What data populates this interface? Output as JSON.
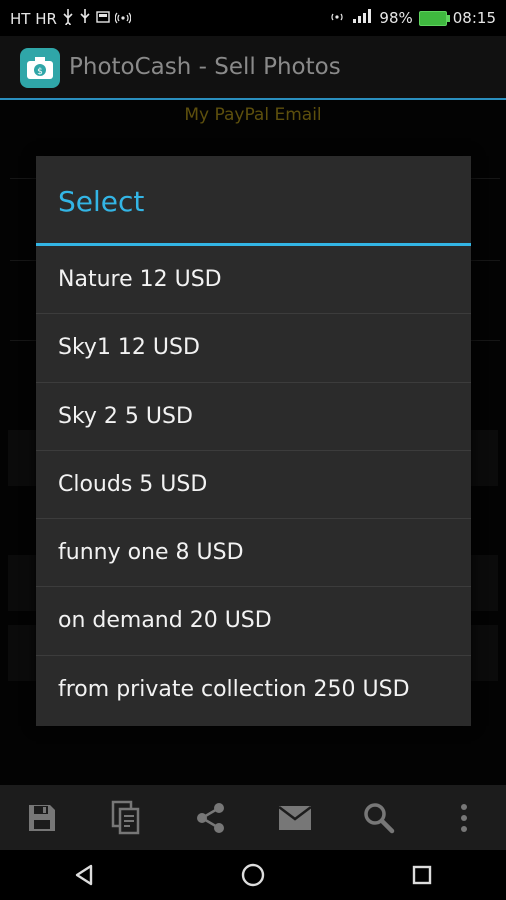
{
  "status_bar": {
    "carrier": "HT HR",
    "battery_percent": "98%",
    "time": "08:15"
  },
  "app_bar": {
    "title": "PhotoCash - Sell Photos"
  },
  "background": {
    "paypal_label": "My PayPal Email"
  },
  "dialog": {
    "title": "Select",
    "options": [
      "Nature 12 USD",
      "Sky1 12 USD",
      "Sky 2 5 USD",
      "Clouds 5 USD",
      "funny one 8 USD",
      "on demand 20 USD",
      "from private collection 250 USD"
    ]
  },
  "toolbar": {
    "icons": [
      "save-icon",
      "copy-icon",
      "share-icon",
      "email-icon",
      "search-icon",
      "more-icon"
    ]
  },
  "nav": {
    "icons": [
      "back-icon",
      "home-icon",
      "recents-icon"
    ]
  },
  "colors": {
    "accent": "#33b5e5",
    "dialog_bg": "#2b2b2b",
    "app_icon": "#2fa6a8",
    "paypal_label": "#8f7a14"
  }
}
